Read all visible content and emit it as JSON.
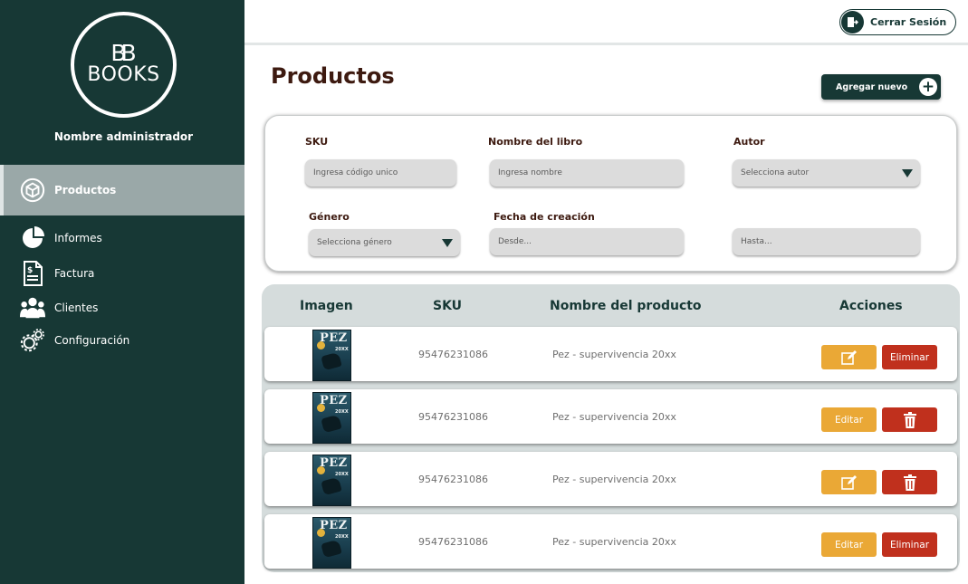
{
  "brand": {
    "mark": "BB",
    "name": "BOOKS"
  },
  "admin_name": "Nombre administrador",
  "nav": [
    {
      "label": "Productos",
      "icon": "box-icon"
    },
    {
      "label": "Informes",
      "icon": "pie-chart-icon"
    },
    {
      "label": "Factura",
      "icon": "invoice-icon"
    },
    {
      "label": "Clientes",
      "icon": "users-icon"
    },
    {
      "label": "Configuración",
      "icon": "gears-icon"
    }
  ],
  "topbar": {
    "logout_label": "Cerrar Sesión"
  },
  "page": {
    "title": "Productos",
    "add_label": "Agregar nuevo"
  },
  "filters": {
    "sku": {
      "label": "SKU",
      "placeholder": "Ingresa código unico"
    },
    "nombre": {
      "label": "Nombre del libro",
      "placeholder": "Ingresa nombre"
    },
    "autor": {
      "label": "Autor",
      "placeholder": "Selecciona autor"
    },
    "genero": {
      "label": "Género",
      "placeholder": "Selecciona género"
    },
    "fecha": {
      "label": "Fecha de creación",
      "desde": "Desde...",
      "hasta": "Hasta..."
    }
  },
  "table": {
    "headers": {
      "imagen": "Imagen",
      "sku": "SKU",
      "nombre": "Nombre del producto",
      "acciones": "Acciones"
    },
    "cover": {
      "title": "PEZ",
      "year": "20XX"
    },
    "rows": [
      {
        "sku": "95476231086",
        "name": "Pez - supervivencia 20xx",
        "edit": "",
        "edit_icon": "edit-icon",
        "delete": "Eliminar",
        "delete_icon": ""
      },
      {
        "sku": "95476231086",
        "name": "Pez - supervivencia 20xx",
        "edit": "Editar",
        "edit_icon": "",
        "delete": "",
        "delete_icon": "trash-icon"
      },
      {
        "sku": "95476231086",
        "name": "Pez - supervivencia 20xx",
        "edit": "",
        "edit_icon": "edit-icon",
        "delete": "",
        "delete_icon": "trash-icon"
      },
      {
        "sku": "95476231086",
        "name": "Pez - supervivencia 20xx",
        "edit": "Editar",
        "edit_icon": "",
        "delete": "Eliminar",
        "delete_icon": ""
      }
    ]
  },
  "colors": {
    "sidebar": "#173835",
    "accent_edit": "#eaa836",
    "accent_delete": "#c0301d",
    "title": "#3d1a10"
  }
}
